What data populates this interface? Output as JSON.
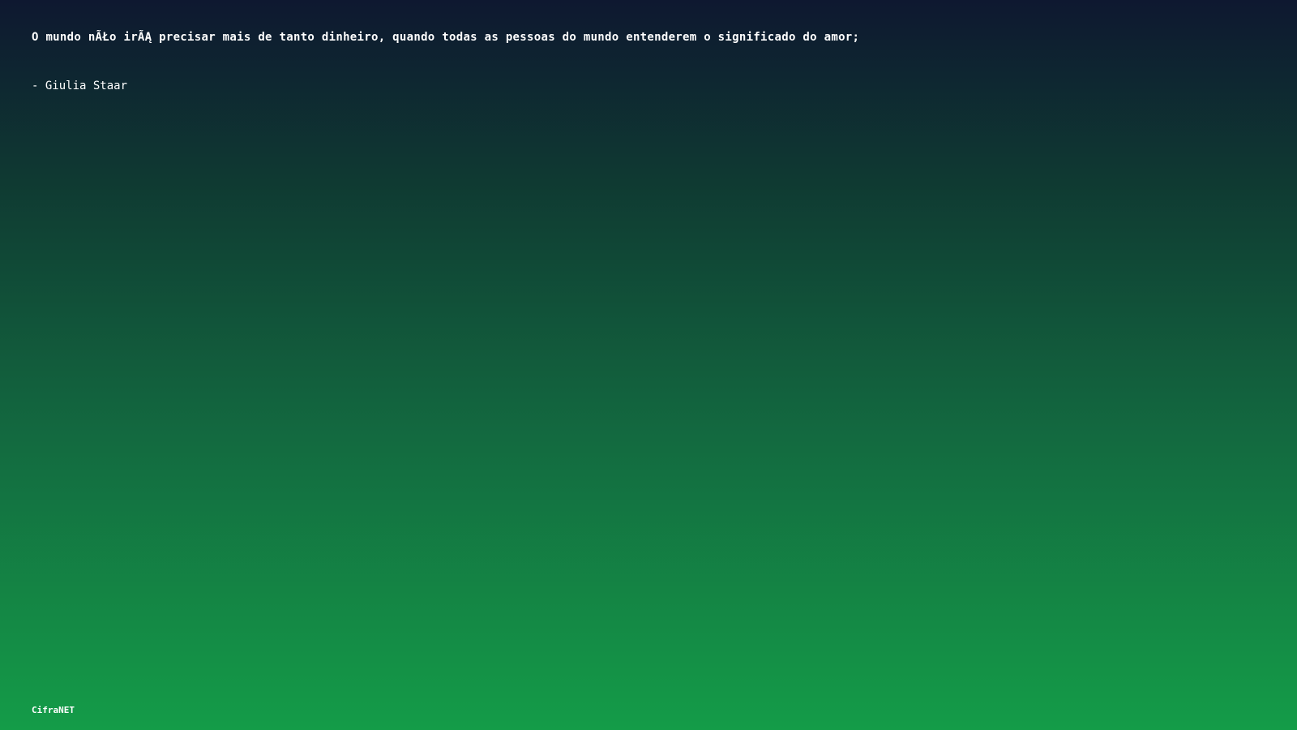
{
  "quote": {
    "text": "O mundo nÃŁo irÃĄ precisar mais de tanto dinheiro, quando todas as pessoas do mundo entenderem o significado do amor;",
    "author": "- Giulia Staar"
  },
  "footer": {
    "brand": "CifraNET"
  },
  "colors": {
    "gradient_top": "#0e1830",
    "gradient_bottom": "#149c48",
    "text": "#ffffff"
  }
}
